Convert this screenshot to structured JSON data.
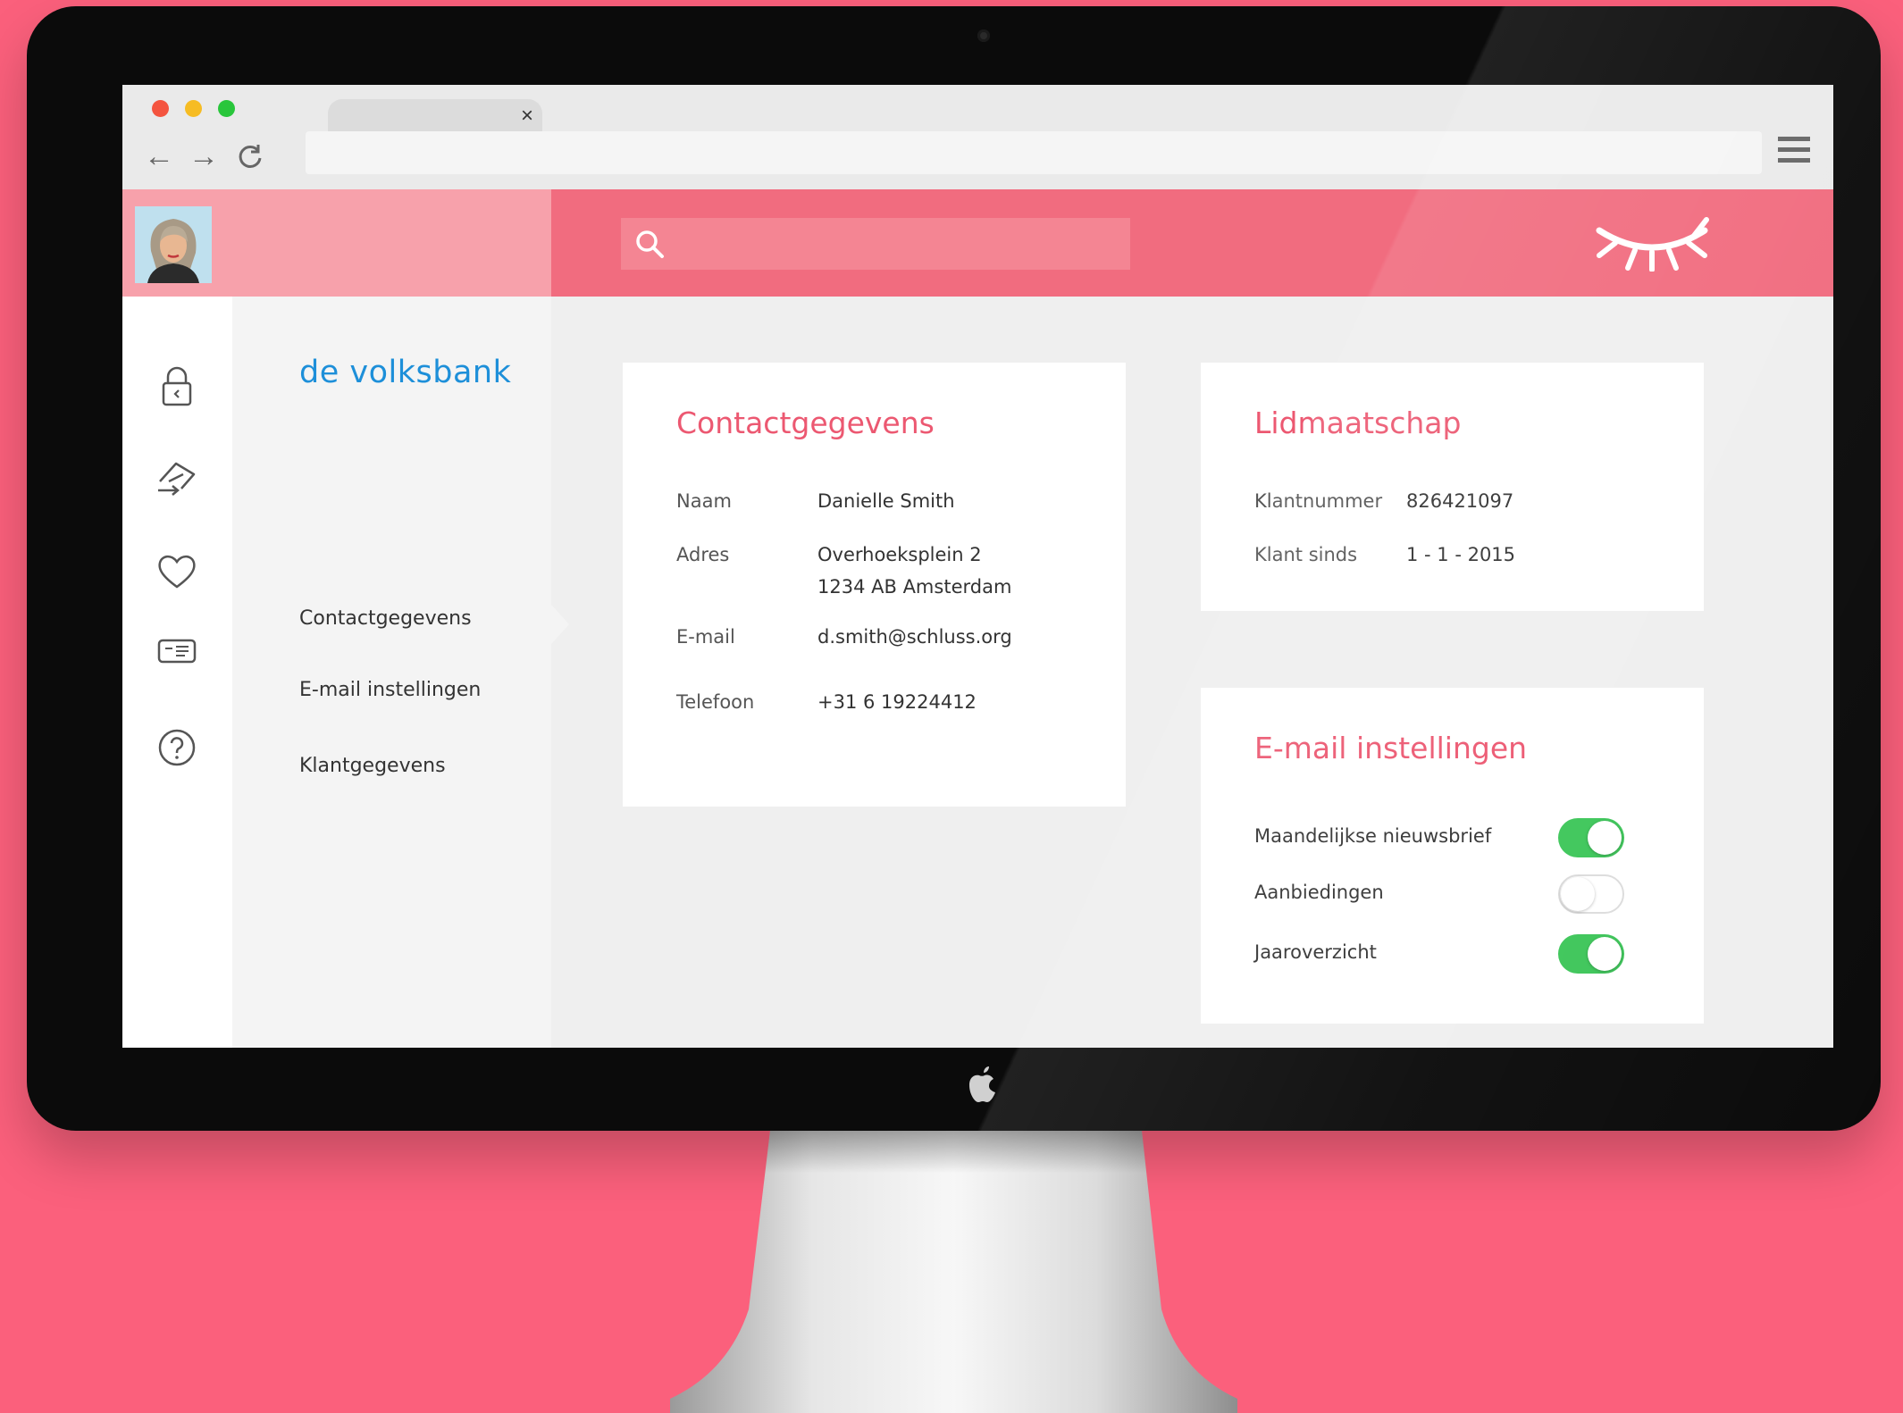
{
  "browser": {
    "tab_close": "×",
    "back": "←",
    "forward": "→",
    "reload": "C",
    "url": ""
  },
  "header": {
    "search_placeholder": ""
  },
  "brand": {
    "name": "de volksbank"
  },
  "nav": {
    "items": [
      {
        "label": "Contactgegevens"
      },
      {
        "label": "E-mail instellingen"
      },
      {
        "label": "Klantgegevens"
      }
    ]
  },
  "icons": {
    "sidebar": [
      "lock-icon",
      "transfer-icon",
      "heart-icon",
      "card-icon",
      "help-icon"
    ],
    "header": [
      "search-icon",
      "closed-eye-icon"
    ]
  },
  "contact": {
    "title": "Contactgegevens",
    "rows": [
      {
        "label": "Naam",
        "value": "Danielle Smith"
      },
      {
        "label": "Adres",
        "value": "Overhoeksplein 2",
        "value2": "1234 AB Amsterdam"
      },
      {
        "label": "E-mail",
        "value": "d.smith@schluss.org"
      },
      {
        "label": "Telefoon",
        "value": "+31 6 19224412"
      }
    ]
  },
  "membership": {
    "title": "Lidmaatschap",
    "rows": [
      {
        "label": "Klantnummer",
        "value": "826421097"
      },
      {
        "label": "Klant sinds",
        "value": "1 - 1 - 2015"
      }
    ]
  },
  "email_settings": {
    "title": "E-mail instellingen",
    "toggles": [
      {
        "label": "Maandelijkse nieuwsbrief",
        "on": true
      },
      {
        "label": "Aanbiedingen",
        "on": false
      },
      {
        "label": "Jaaroverzicht",
        "on": true
      }
    ]
  },
  "colors": {
    "background": "#fb607c",
    "header_accent": "#f16c7f",
    "title_pink": "#ec5871",
    "brand_blue": "#1d8fd9",
    "toggle_on": "#3ec65a"
  }
}
